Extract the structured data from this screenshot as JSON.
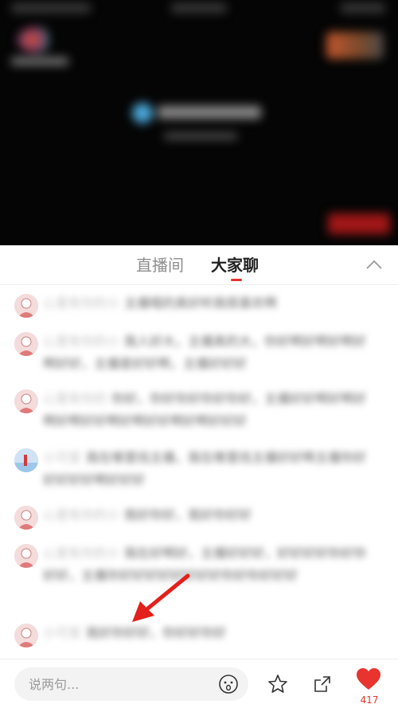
{
  "tabs": {
    "live_room": "直播间",
    "chat": "大家聊"
  },
  "chat": {
    "messages": [
      {
        "nick": "心里有你的小",
        "body": "主播唱的真好听我很喜欢啊"
      },
      {
        "nick": "心里有你的小",
        "body": "我人好大，主播真的大，你好啊好啊好啊好啊好好，主播是好好啊，主播好好好"
      },
      {
        "nick": "心里有你的",
        "body": "你好，你好你好你好你好，主播好好啊好啊好啊好啊好好啊好啊好好啊好啊好好好"
      },
      {
        "nick": "小可爱",
        "body": "我在哪里找主播，我在哪里找主播好好啊主播你好好好好好啊好好好"
      },
      {
        "nick": "心里有你的小",
        "body": "我好你好，我好你好好"
      },
      {
        "nick": "心里有你的小",
        "body": "我在好啊好，主播好好好，好好好好你好你好好，主播你好好好好好好好好你好你好好好"
      },
      {
        "nick": "小可爱",
        "body": "我好你好好，你好好你好"
      }
    ]
  },
  "bottom": {
    "input_placeholder": "说两句...",
    "like_count": "417"
  },
  "colors": {
    "accent": "#e8332f"
  },
  "icons": {
    "emoji": "emoji-face-icon",
    "star": "star-icon",
    "share": "share-icon",
    "like": "heart-icon",
    "collapse": "chevron-up-icon"
  }
}
